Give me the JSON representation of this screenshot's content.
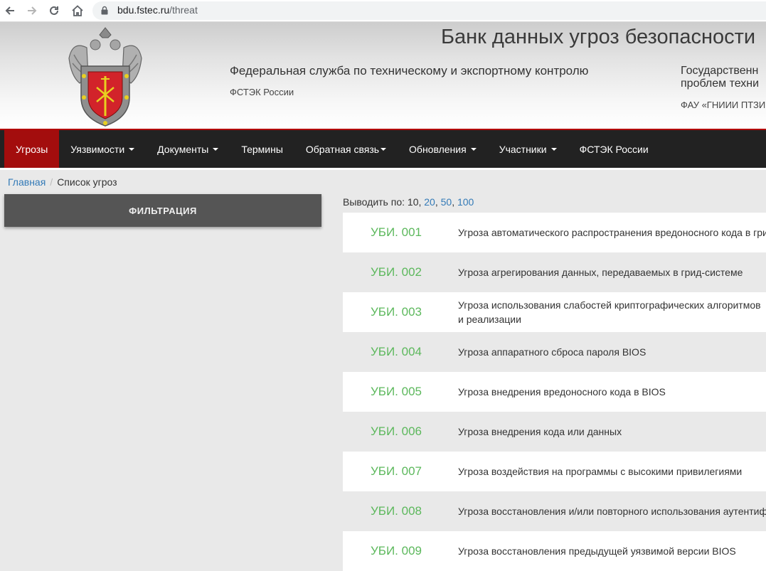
{
  "browser": {
    "url_host": "bdu.fstec.ru",
    "url_path": "/threat"
  },
  "header": {
    "title": "Банк данных угроз безопасности",
    "org_name": "Федеральная служба по техническому и экспортному контролю",
    "org_short": "ФСТЭК России",
    "org2_name_line1": "Государственн",
    "org2_name_line2": "проблем техни",
    "org2_short": "ФАУ «ГНИИИ ПТЗИ"
  },
  "nav": {
    "items": [
      {
        "label": "Угрозы",
        "dropdown": false,
        "active": true
      },
      {
        "label": "Уязвимости",
        "dropdown": true,
        "active": false
      },
      {
        "label": "Документы",
        "dropdown": true,
        "active": false
      },
      {
        "label": "Термины",
        "dropdown": false,
        "active": false
      },
      {
        "label": "Обратная связь",
        "dropdown": true,
        "active": false
      },
      {
        "label": "Обновления",
        "dropdown": true,
        "active": false
      },
      {
        "label": "Участники",
        "dropdown": true,
        "active": false
      },
      {
        "label": "ФСТЭК России",
        "dropdown": false,
        "active": false
      }
    ]
  },
  "breadcrumb": {
    "home": "Главная",
    "separator": "/",
    "current": "Список угроз"
  },
  "filter": {
    "label": "ФИЛЬТРАЦИЯ"
  },
  "per_page": {
    "label": "Выводить по:",
    "current": "10,",
    "opt_20": "20",
    "comma1": ",",
    "opt_50": "50",
    "comma2": ",",
    "opt_100": "100"
  },
  "threats": [
    {
      "id": "УБИ. 001",
      "name": "Угроза автоматического распространения вредоносного кода в гри"
    },
    {
      "id": "УБИ. 002",
      "name": "Угроза агрегирования данных, передаваемых в грид-системе"
    },
    {
      "id": "УБИ. 003",
      "name": "Угроза использования слабостей криптографических алгоритмов и реализации"
    },
    {
      "id": "УБИ. 004",
      "name": "Угроза аппаратного сброса пароля BIOS"
    },
    {
      "id": "УБИ. 005",
      "name": "Угроза внедрения вредоносного кода в BIOS"
    },
    {
      "id": "УБИ. 006",
      "name": "Угроза внедрения кода или данных"
    },
    {
      "id": "УБИ. 007",
      "name": "Угроза воздействия на программы с высокими привилегиями"
    },
    {
      "id": "УБИ. 008",
      "name": "Угроза восстановления и/или повторного использования аутентиф"
    },
    {
      "id": "УБИ. 009",
      "name": "Угроза восстановления предыдущей уязвимой версии BIOS"
    }
  ],
  "colors": {
    "nav_bg": "#222222",
    "nav_active": "#a30d0d",
    "threat_id": "#5cb85c",
    "link": "#337ab7"
  }
}
